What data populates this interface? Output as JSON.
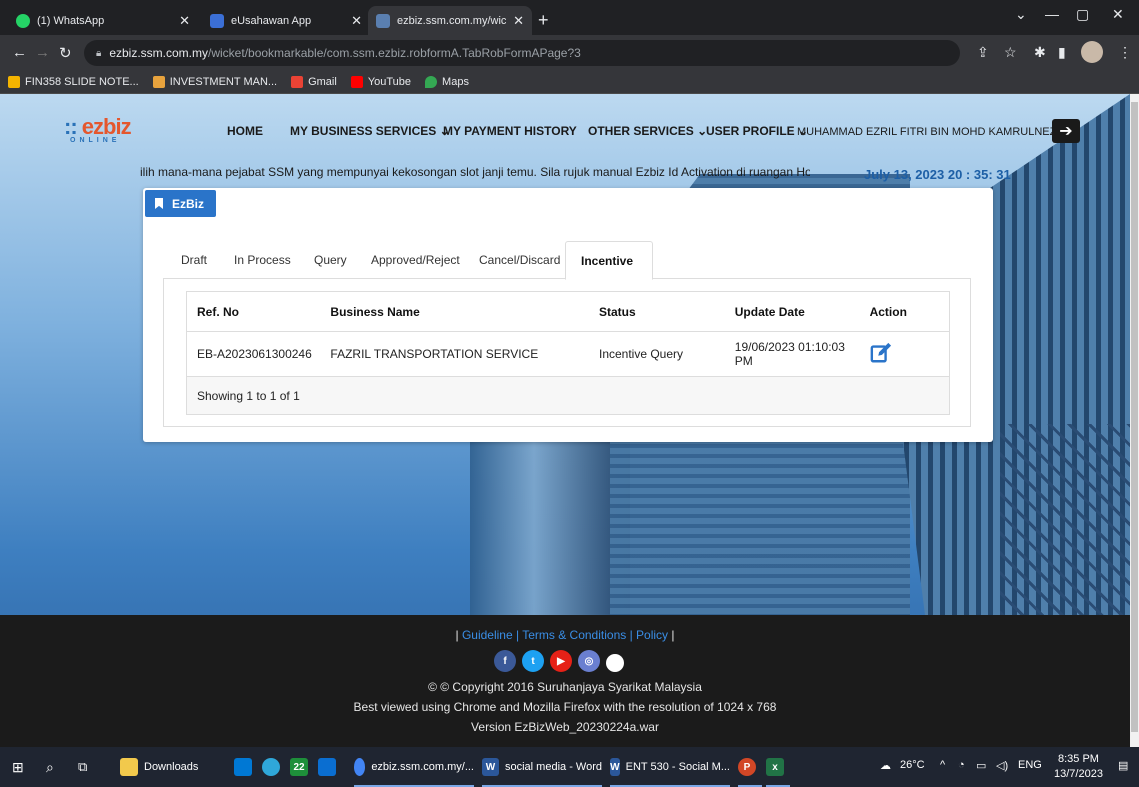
{
  "browser": {
    "tabs": [
      {
        "title": "(1) WhatsApp",
        "active": false,
        "icon": "whatsapp-icon",
        "color": "#25d366"
      },
      {
        "title": "eUsahawan App",
        "active": false,
        "icon": "eusahawan-icon",
        "color": "#3b6fd6"
      },
      {
        "title": "ezbiz.ssm.com.my/wicket/bookm",
        "active": true,
        "icon": "ezbiz-icon",
        "color": "#5a7fb0"
      }
    ],
    "url_domain": "ezbiz.ssm.com.my",
    "url_path": "/wicket/bookmarkable/com.ssm.ezbiz.robformA.TabRobFormAPage?3",
    "bookmarks": [
      {
        "label": "FIN358 SLIDE NOTE...",
        "icon": "drive-icon",
        "color": "#f4b400"
      },
      {
        "label": "INVESTMENT MAN...",
        "icon": "bookmark-icon",
        "color": "#e8a33d"
      },
      {
        "label": "Gmail",
        "icon": "gmail-icon",
        "color": "#ea4335"
      },
      {
        "label": "YouTube",
        "icon": "youtube-icon",
        "color": "#ff0000"
      },
      {
        "label": "Maps",
        "icon": "maps-icon",
        "color": "#34a853"
      }
    ]
  },
  "site": {
    "logo_main": "ezbiz",
    "logo_sub": "ONLINE",
    "menu": {
      "home": "HOME",
      "business": "MY BUSINESS SERVICES",
      "payment": "MY PAYMENT HISTORY",
      "other": "OTHER SERVICES",
      "profile": "USER PROFILE"
    },
    "user_name": "MUHAMMAD EZRIL FITRI BIN MOHD KAMRULNEZAM",
    "marquee": "ilih mana-mana pejabat SSM yang mempunyai kekosongan slot janji temu. Sila rujuk manual Ezbiz Id Activation di ruangan Home untuk rujuk",
    "datetime": "July 13, 2023 20 : 35: 31"
  },
  "card": {
    "badge": "EzBiz",
    "tabs": [
      "Draft",
      "In Process",
      "Query",
      "Approved/Reject",
      "Cancel/Discard",
      "Incentive"
    ],
    "active_tab": "Incentive",
    "table": {
      "headers": [
        "Ref. No",
        "Business Name",
        "Status",
        "Update Date",
        "Action"
      ],
      "rows": [
        {
          "ref": "EB-A2023061300246",
          "name": "FAZRIL TRANSPORTATION SERVICE",
          "status": "Incentive Query",
          "date": "19/06/2023 01:10:03 PM",
          "action": "edit-icon"
        }
      ],
      "summary": "Showing 1 to 1 of 1"
    }
  },
  "footer": {
    "sep_left": "| ",
    "guideline": "Guideline",
    "terms": " | Terms & Conditions",
    "policy": " | Policy",
    "sep_right": " |",
    "copyright": "© © Copyright 2016 Suruhanjaya Syarikat Malaysia",
    "best_viewed": "Best viewed using Chrome and Mozilla Firefox with the resolution of 1024 x 768",
    "version": "Version EzBizWeb_20230224a.war",
    "socials": [
      {
        "icon": "facebook-icon",
        "glyph": "f",
        "color": "#3b5998"
      },
      {
        "icon": "twitter-icon",
        "glyph": "t",
        "color": "#1da1f2"
      },
      {
        "icon": "youtube-icon",
        "glyph": "▶",
        "color": "#e62117"
      },
      {
        "icon": "instagram-icon",
        "glyph": "◎",
        "color": "#6a7fd0"
      }
    ]
  },
  "taskbar": {
    "apps": [
      {
        "label": "Downloads",
        "icon": "folder-icon",
        "color": "#f2c94c"
      },
      {
        "label": "",
        "icon": "store-icon",
        "color": "#0078d4"
      },
      {
        "label": "",
        "icon": "edge-icon",
        "color": "#2fa7d9"
      },
      {
        "label": "22",
        "icon": "calendar-app-icon",
        "color": "#1e8f3a"
      },
      {
        "label": "",
        "icon": "mail-icon",
        "color": "#0a6ed1"
      },
      {
        "label": "ezbiz.ssm.com.my/...",
        "icon": "chrome-icon",
        "color": "#4285f4"
      },
      {
        "label": "social media - Word",
        "icon": "word-icon",
        "color": "#2b579a"
      },
      {
        "label": "ENT 530 - Social M...",
        "icon": "word-icon",
        "color": "#2b579a"
      },
      {
        "label": "",
        "icon": "powerpoint-icon",
        "color": "#d24726"
      },
      {
        "label": "",
        "icon": "excel-icon",
        "color": "#217346"
      }
    ],
    "weather": "26°C",
    "lang": "ENG",
    "time": "8:35 PM",
    "date": "13/7/2023"
  }
}
